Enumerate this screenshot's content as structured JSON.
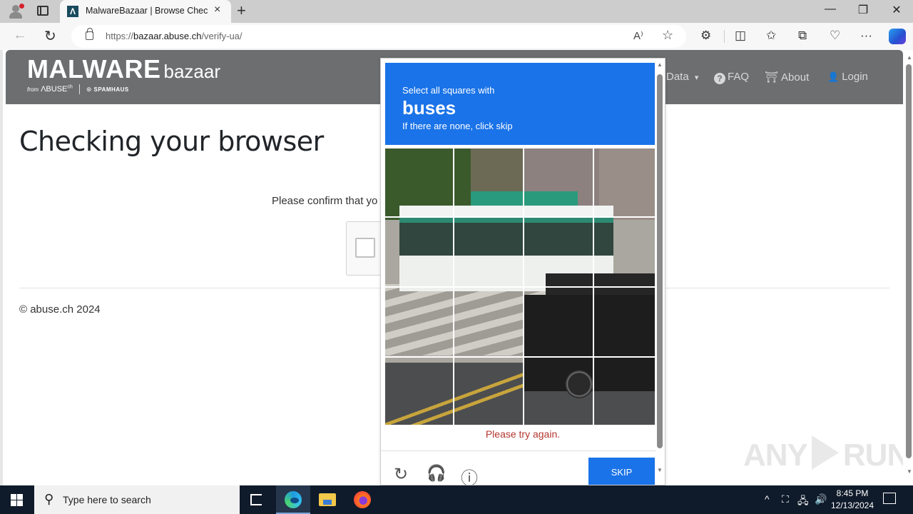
{
  "browser": {
    "tab_title": "MalwareBazaar | Browse Checking your browser",
    "favicon_glyph": "Λ",
    "url_scheme": "https://",
    "url_host": "bazaar.abuse.ch",
    "url_path": "/verify-ua/",
    "icons": {
      "profile": "profile-icon",
      "tab_actions": "tab-actions-icon",
      "close_tab": "×",
      "new_tab": "+",
      "minimize": "—",
      "maximize": "❐",
      "close_window": "✕",
      "back": "←",
      "reload": "↻",
      "read_aloud": "A⁾",
      "favorite": "☆",
      "extensions": "⚙",
      "split_screen": "◫",
      "favorites": "✩",
      "collections": "⧉",
      "browser_essentials": "♡",
      "more": "···"
    }
  },
  "site": {
    "logo_main": "MALWARE",
    "logo_bazaar": "bazaar",
    "logo_from": "from",
    "logo_abuse": "ΛBUSE",
    "logo_ch": "ch",
    "logo_spamhaus": "SPAMHAUS",
    "nav": [
      {
        "label": "Data",
        "icon": "▾"
      },
      {
        "label": "FAQ",
        "icon": "?"
      },
      {
        "label": "About",
        "icon": "⛩"
      },
      {
        "label": "Login",
        "icon": "👤"
      }
    ]
  },
  "page": {
    "title": "Checking your browser",
    "confirm_text": "Please confirm that yo",
    "footer": "© abuse.ch 2024"
  },
  "captcha": {
    "instruction_line1": "Select all squares with",
    "target": "buses",
    "instruction_line3": "If there are none, click skip",
    "grid_rows": 4,
    "grid_cols": 4,
    "error": "Please try again.",
    "skip_label": "SKIP",
    "icons": {
      "reload": "↻",
      "audio": "🎧",
      "info": "ⓘ"
    },
    "header_color": "#1a73e8",
    "error_color": "#b3362f"
  },
  "watermark": {
    "left": "ANY",
    "right": "RUN"
  },
  "taskbar": {
    "search_placeholder": "Type here to search",
    "time": "8:45 PM",
    "date": "12/13/2024",
    "tray_icons": [
      "^",
      "⛶",
      "🖧",
      "🔊"
    ]
  }
}
